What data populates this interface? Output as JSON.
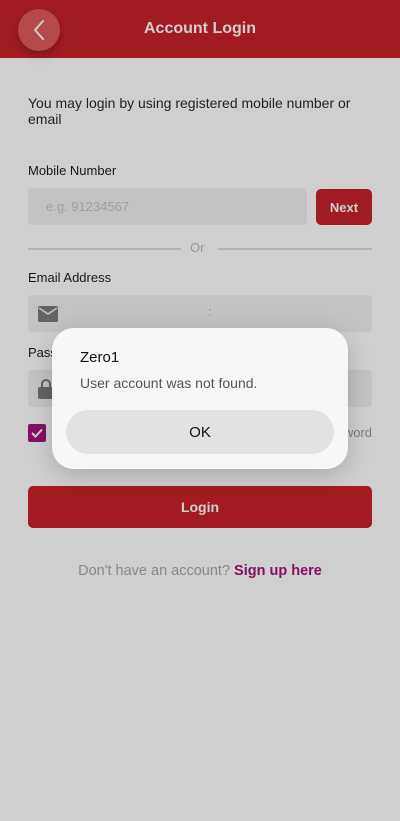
{
  "header": {
    "title": "Account Login",
    "back_icon": "chevron-left-icon"
  },
  "intro_text": "You may login by using registered mobile number or email",
  "mobile": {
    "label": "Mobile Number",
    "placeholder": "e.g. 91234567",
    "next_label": "Next"
  },
  "divider_text": "Or",
  "email": {
    "label": "Email Address",
    "icon": "mail-icon",
    "separator": ":"
  },
  "password": {
    "label": "Pass",
    "icon": "lock-icon"
  },
  "remember": {
    "checked": true,
    "forgot_fragment": "word"
  },
  "login_label": "Login",
  "signup": {
    "prompt": "Don't have an account?",
    "link": "Sign up here"
  },
  "dialog": {
    "title": "Zero1",
    "message": "User account was not found.",
    "ok_label": "OK"
  },
  "colors": {
    "brand_red": "#c8222a",
    "accent_purple": "#a0157a"
  }
}
